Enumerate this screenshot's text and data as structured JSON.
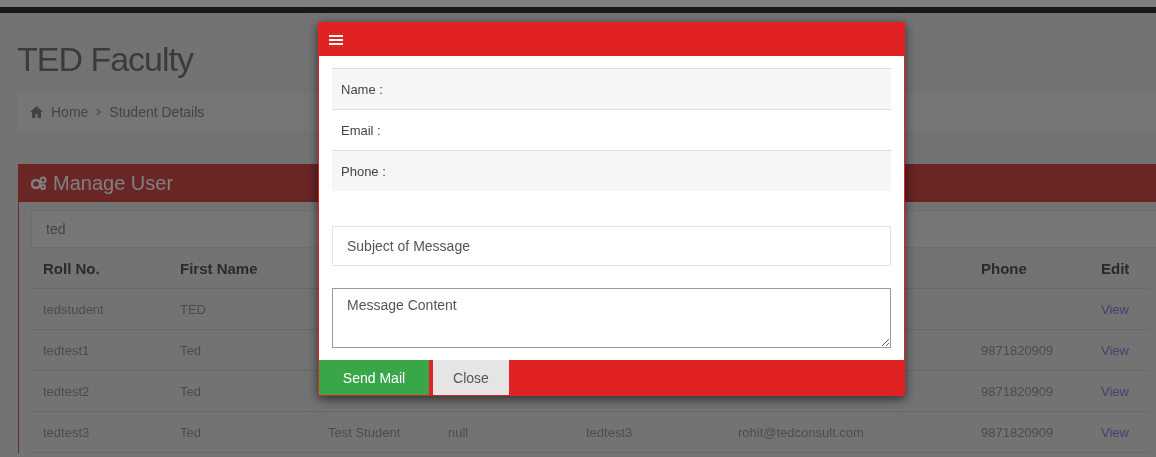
{
  "page_title": "TED Faculty",
  "breadcrumb": [
    {
      "label": "Home"
    },
    {
      "label": "Student Details"
    }
  ],
  "panel": {
    "title": "Manage User",
    "search": {
      "value": "ted"
    },
    "table": {
      "columns": [
        "Roll No.",
        "First Name",
        "Phone",
        "Edit"
      ],
      "rows": [
        {
          "roll_no": "tedstudent",
          "first_name": "TED",
          "edit": "View"
        },
        {
          "roll_no": "tedtest1",
          "first_name": "Ted",
          "phone": "9871820909",
          "edit": "View"
        },
        {
          "roll_no": "tedtest2",
          "first_name": "Ted",
          "phone": "9871820909",
          "edit": "View"
        },
        {
          "roll_no": "tedtest3",
          "first_name": "Ted",
          "column_3": "Test Student",
          "column_4": "null",
          "column_5": "tedtest3",
          "column_6": "rohit@tedconsult.com",
          "phone": "9871820909",
          "edit": "View"
        }
      ]
    }
  },
  "modal": {
    "info_rows": [
      {
        "label": "Name :"
      },
      {
        "label": "Email :"
      },
      {
        "label": "Phone :"
      }
    ],
    "subject_field": {
      "placeholder": "Subject of Message"
    },
    "message_field": {
      "value": "Message Content"
    },
    "buttons": [
      {
        "label": "Send Mail",
        "kind": "primary"
      },
      {
        "label": "Close",
        "kind": "secondary"
      }
    ]
  }
}
